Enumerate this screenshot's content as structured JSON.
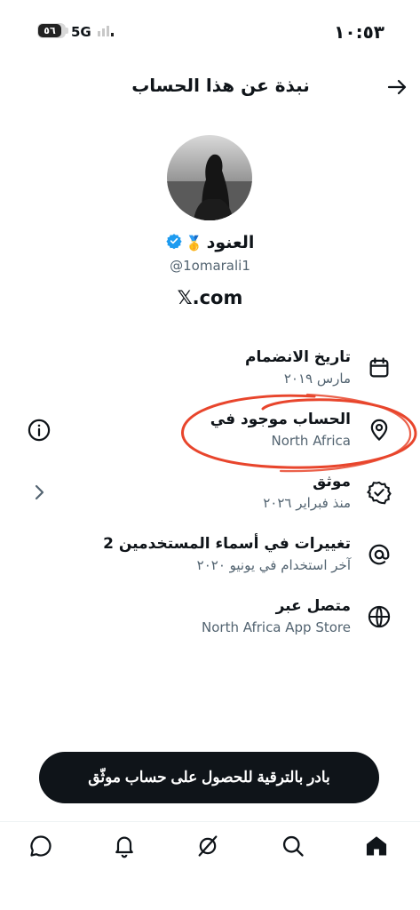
{
  "status_bar": {
    "time": "١٠:٥٣",
    "network": "5G",
    "battery_level": "٥٦"
  },
  "header": {
    "title": "نبذة عن هذا الحساب"
  },
  "profile": {
    "name": "العنود",
    "name_emoji": "🥇",
    "handle": "@1omarali1",
    "domain": "𝕏.com"
  },
  "details": [
    {
      "icon": "calendar-icon",
      "title": "تاريخ الانضمام",
      "subtitle": "مارس ٢٠١٩"
    },
    {
      "icon": "location-pin-icon",
      "title": "الحساب موجود في",
      "subtitle": "North Africa"
    },
    {
      "icon": "verified-badge-icon",
      "title": "موثق",
      "subtitle": "منذ فبراير ٢٠٢٦"
    },
    {
      "icon": "at-sign-icon",
      "title": "2 تغييرات في أسماء المستخدمين",
      "subtitle": "آخر استخدام في يونيو ٢٠٢٠"
    },
    {
      "icon": "globe-icon",
      "title": "متصل عبر",
      "subtitle": "North Africa App Store"
    }
  ],
  "cta": {
    "label": "بادر بالترقية للحصول على حساب موثّق"
  },
  "bottom_nav": [
    "messages-icon",
    "notifications-icon",
    "grok-icon",
    "search-icon",
    "home-icon"
  ],
  "colors": {
    "accent_blue": "#1d9bf0",
    "annotation_red": "#e8452c",
    "text_primary": "#0f1419",
    "text_secondary": "#536471"
  }
}
